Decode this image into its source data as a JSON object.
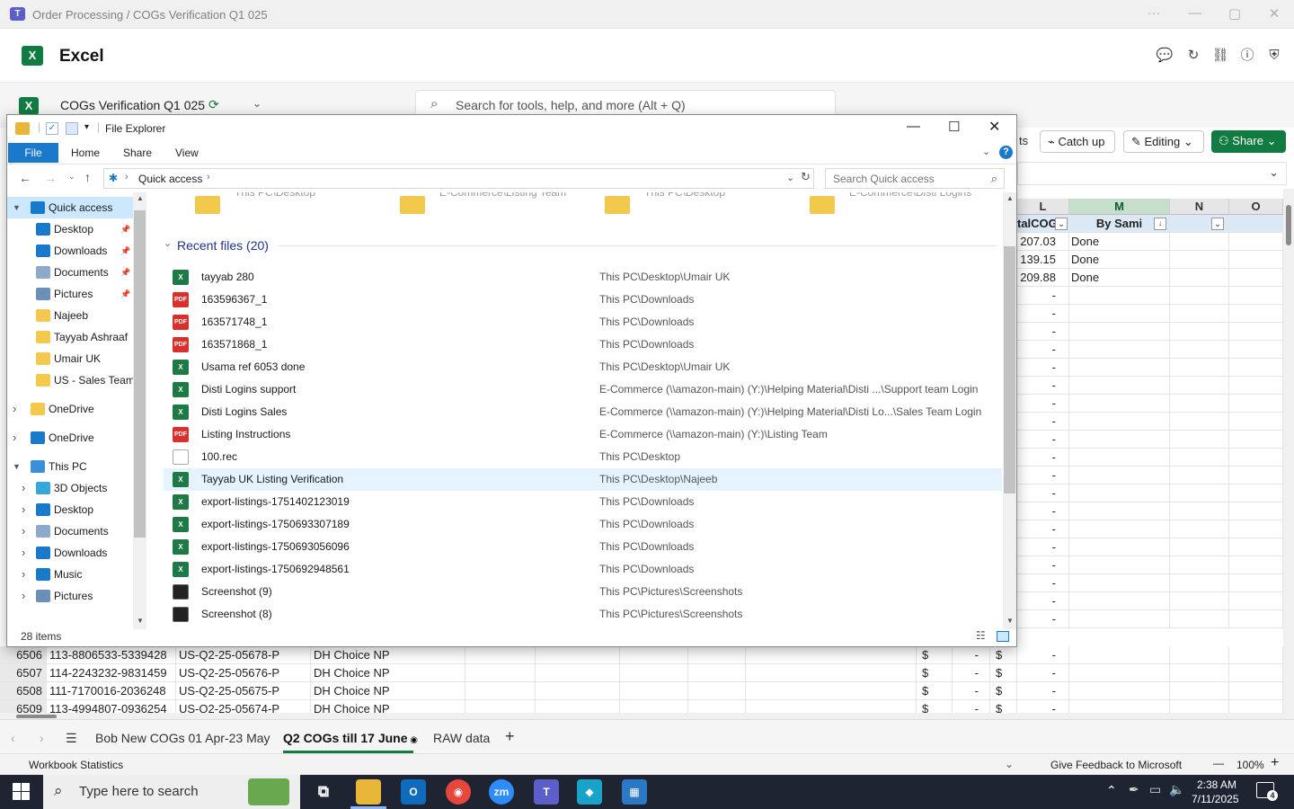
{
  "teams": {
    "title": "Order Processing / COGs Verification Q1 025",
    "logo": "T"
  },
  "excel": {
    "app_name": "Excel",
    "logo": "X",
    "doc_title": "COGs Verification Q1 025",
    "search_placeholder": "Search for tools, help, and more (Alt + Q)",
    "catch_up": "Catch up",
    "editing": "Editing",
    "share": "Share",
    "ribbon_partial": "ts"
  },
  "grid": {
    "columns": [
      "L",
      "M",
      "N",
      "O"
    ],
    "header_row": {
      "L": "talCOG",
      "M": "By Sami"
    },
    "top_rows": [
      {
        "l": "207.03",
        "m": "Done"
      },
      {
        "l": "139.15",
        "m": "Done"
      },
      {
        "l": "209.88",
        "m": "Done"
      }
    ],
    "dash": "-",
    "bottom_rows": [
      {
        "num": "6506",
        "a": "113-8806533-5339428",
        "b": "US-Q2-25-05678-P",
        "c": "DH Choice NP",
        "cur1": "$",
        "dash1": "-",
        "cur2": "$",
        "dash2": "-"
      },
      {
        "num": "6507",
        "a": "114-2243232-9831459",
        "b": "US-Q2-25-05676-P",
        "c": "DH Choice NP",
        "cur1": "$",
        "dash1": "-",
        "cur2": "$",
        "dash2": "-"
      },
      {
        "num": "6508",
        "a": "111-7170016-2036248",
        "b": "US-Q2-25-05675-P",
        "c": "DH Choice NP",
        "cur1": "$",
        "dash1": "-",
        "cur2": "$",
        "dash2": "-"
      },
      {
        "num": "6509",
        "a": "113-4994807-0936254",
        "b": "US-Q2-25-05674-P",
        "c": "DH Choice NP",
        "cur1": "$",
        "dash1": "-",
        "cur2": "$",
        "dash2": "-"
      }
    ]
  },
  "sheet_tabs": [
    "Bob New COGs 01 Apr-23 May",
    "Q2 COGs till 17 June",
    "RAW data"
  ],
  "status": {
    "left": "Workbook Statistics",
    "feedback": "Give Feedback to Microsoft",
    "zoom": "100%",
    "minus": "—",
    "plus": "+"
  },
  "explorer": {
    "title": "File Explorer",
    "ribbon_tabs": [
      "File",
      "Home",
      "Share",
      "View"
    ],
    "address": "Quick access",
    "search_placeholder": "Search Quick access",
    "item_count": "28 items",
    "section_title": "Recent files (20)",
    "nav": [
      {
        "label": "Quick access",
        "indent": 0,
        "expander": "open",
        "icon": "star",
        "selected": true,
        "pinned": false
      },
      {
        "label": "Desktop",
        "indent": 1,
        "expander": "",
        "icon": "desktop",
        "pinned": true
      },
      {
        "label": "Downloads",
        "indent": 1,
        "expander": "",
        "icon": "download",
        "pinned": true
      },
      {
        "label": "Documents",
        "indent": 1,
        "expander": "",
        "icon": "document",
        "pinned": true
      },
      {
        "label": "Pictures",
        "indent": 1,
        "expander": "",
        "icon": "pictures",
        "pinned": true
      },
      {
        "label": "Najeeb",
        "indent": 1,
        "expander": "",
        "icon": "folder",
        "pinned": false
      },
      {
        "label": "Tayyab Ashraaf",
        "indent": 1,
        "expander": "",
        "icon": "folder",
        "pinned": false
      },
      {
        "label": "Umair UK",
        "indent": 1,
        "expander": "",
        "icon": "folder",
        "pinned": false
      },
      {
        "label": "US - Sales Team",
        "indent": 1,
        "expander": "",
        "icon": "folder",
        "pinned": false
      },
      {
        "label": "OneDrive",
        "indent": 0,
        "expander": "closed",
        "icon": "folder",
        "pinned": false
      },
      {
        "label": "OneDrive",
        "indent": 0,
        "expander": "closed",
        "icon": "cloud",
        "pinned": false
      },
      {
        "label": "This PC",
        "indent": 0,
        "expander": "open",
        "icon": "pc",
        "pinned": false
      },
      {
        "label": "3D Objects",
        "indent": 1,
        "expander": "closed",
        "icon": "cube",
        "pinned": false
      },
      {
        "label": "Desktop",
        "indent": 1,
        "expander": "closed",
        "icon": "desktop",
        "pinned": false
      },
      {
        "label": "Documents",
        "indent": 1,
        "expander": "closed",
        "icon": "document",
        "pinned": false
      },
      {
        "label": "Downloads",
        "indent": 1,
        "expander": "closed",
        "icon": "download",
        "pinned": false
      },
      {
        "label": "Music",
        "indent": 1,
        "expander": "closed",
        "icon": "music",
        "pinned": false
      },
      {
        "label": "Pictures",
        "indent": 1,
        "expander": "closed",
        "icon": "pictures",
        "pinned": false
      }
    ],
    "recent_files": [
      {
        "name": "tayyab 280",
        "type": "xlsx",
        "path": "This PC\\Desktop\\Umair UK"
      },
      {
        "name": "163596367_1",
        "type": "pdf",
        "path": "This PC\\Downloads"
      },
      {
        "name": "163571748_1",
        "type": "pdf",
        "path": "This PC\\Downloads"
      },
      {
        "name": "163571868_1",
        "type": "pdf",
        "path": "This PC\\Downloads"
      },
      {
        "name": "Usama ref 6053 done",
        "type": "xlsx",
        "path": "This PC\\Desktop\\Umair UK"
      },
      {
        "name": "Disti Logins support",
        "type": "xlsx",
        "path": "E-Commerce (\\\\amazon-main) (Y:)\\Helping Material\\Disti ...\\Support team Login"
      },
      {
        "name": "Disti Logins Sales",
        "type": "xlsx",
        "path": "E-Commerce (\\\\amazon-main) (Y:)\\Helping Material\\Disti Lo...\\Sales Team Login"
      },
      {
        "name": "Listing Instructions",
        "type": "pdf",
        "path": "E-Commerce (\\\\amazon-main) (Y:)\\Listing Team"
      },
      {
        "name": "100.rec",
        "type": "rec",
        "path": "This PC\\Desktop"
      },
      {
        "name": "Tayyab UK Listing Verification",
        "type": "xlsx",
        "path": "This PC\\Desktop\\Najeeb",
        "selected": true
      },
      {
        "name": "export-listings-1751402123019",
        "type": "xlsx",
        "path": "This PC\\Downloads"
      },
      {
        "name": "export-listings-1750693307189",
        "type": "xlsx",
        "path": "This PC\\Downloads"
      },
      {
        "name": "export-listings-1750693056096",
        "type": "xlsx",
        "path": "This PC\\Downloads"
      },
      {
        "name": "export-listings-1750692948561",
        "type": "xlsx",
        "path": "This PC\\Downloads"
      },
      {
        "name": "Screenshot (9)",
        "type": "png",
        "path": "This PC\\Pictures\\Screenshots"
      },
      {
        "name": "Screenshot (8)",
        "type": "png",
        "path": "This PC\\Pictures\\Screenshots"
      }
    ],
    "partial_top_labels": [
      "This PC\\Desktop",
      "E-Commerce\\Listing Team",
      "This PC\\Desktop",
      "E-Commerce\\Disti Logins"
    ]
  },
  "taskbar": {
    "search": "Type here to search",
    "time": "2:38 AM",
    "date": "7/11/2025",
    "notification_count": "4",
    "zoom_label": "zm"
  },
  "colors": {
    "excel_green": "#107c41",
    "explorer_blue": "#1979ca",
    "selected_nav": "#cce8ff",
    "pdf_red": "#d9302c",
    "taskbar": "#1f2433"
  }
}
